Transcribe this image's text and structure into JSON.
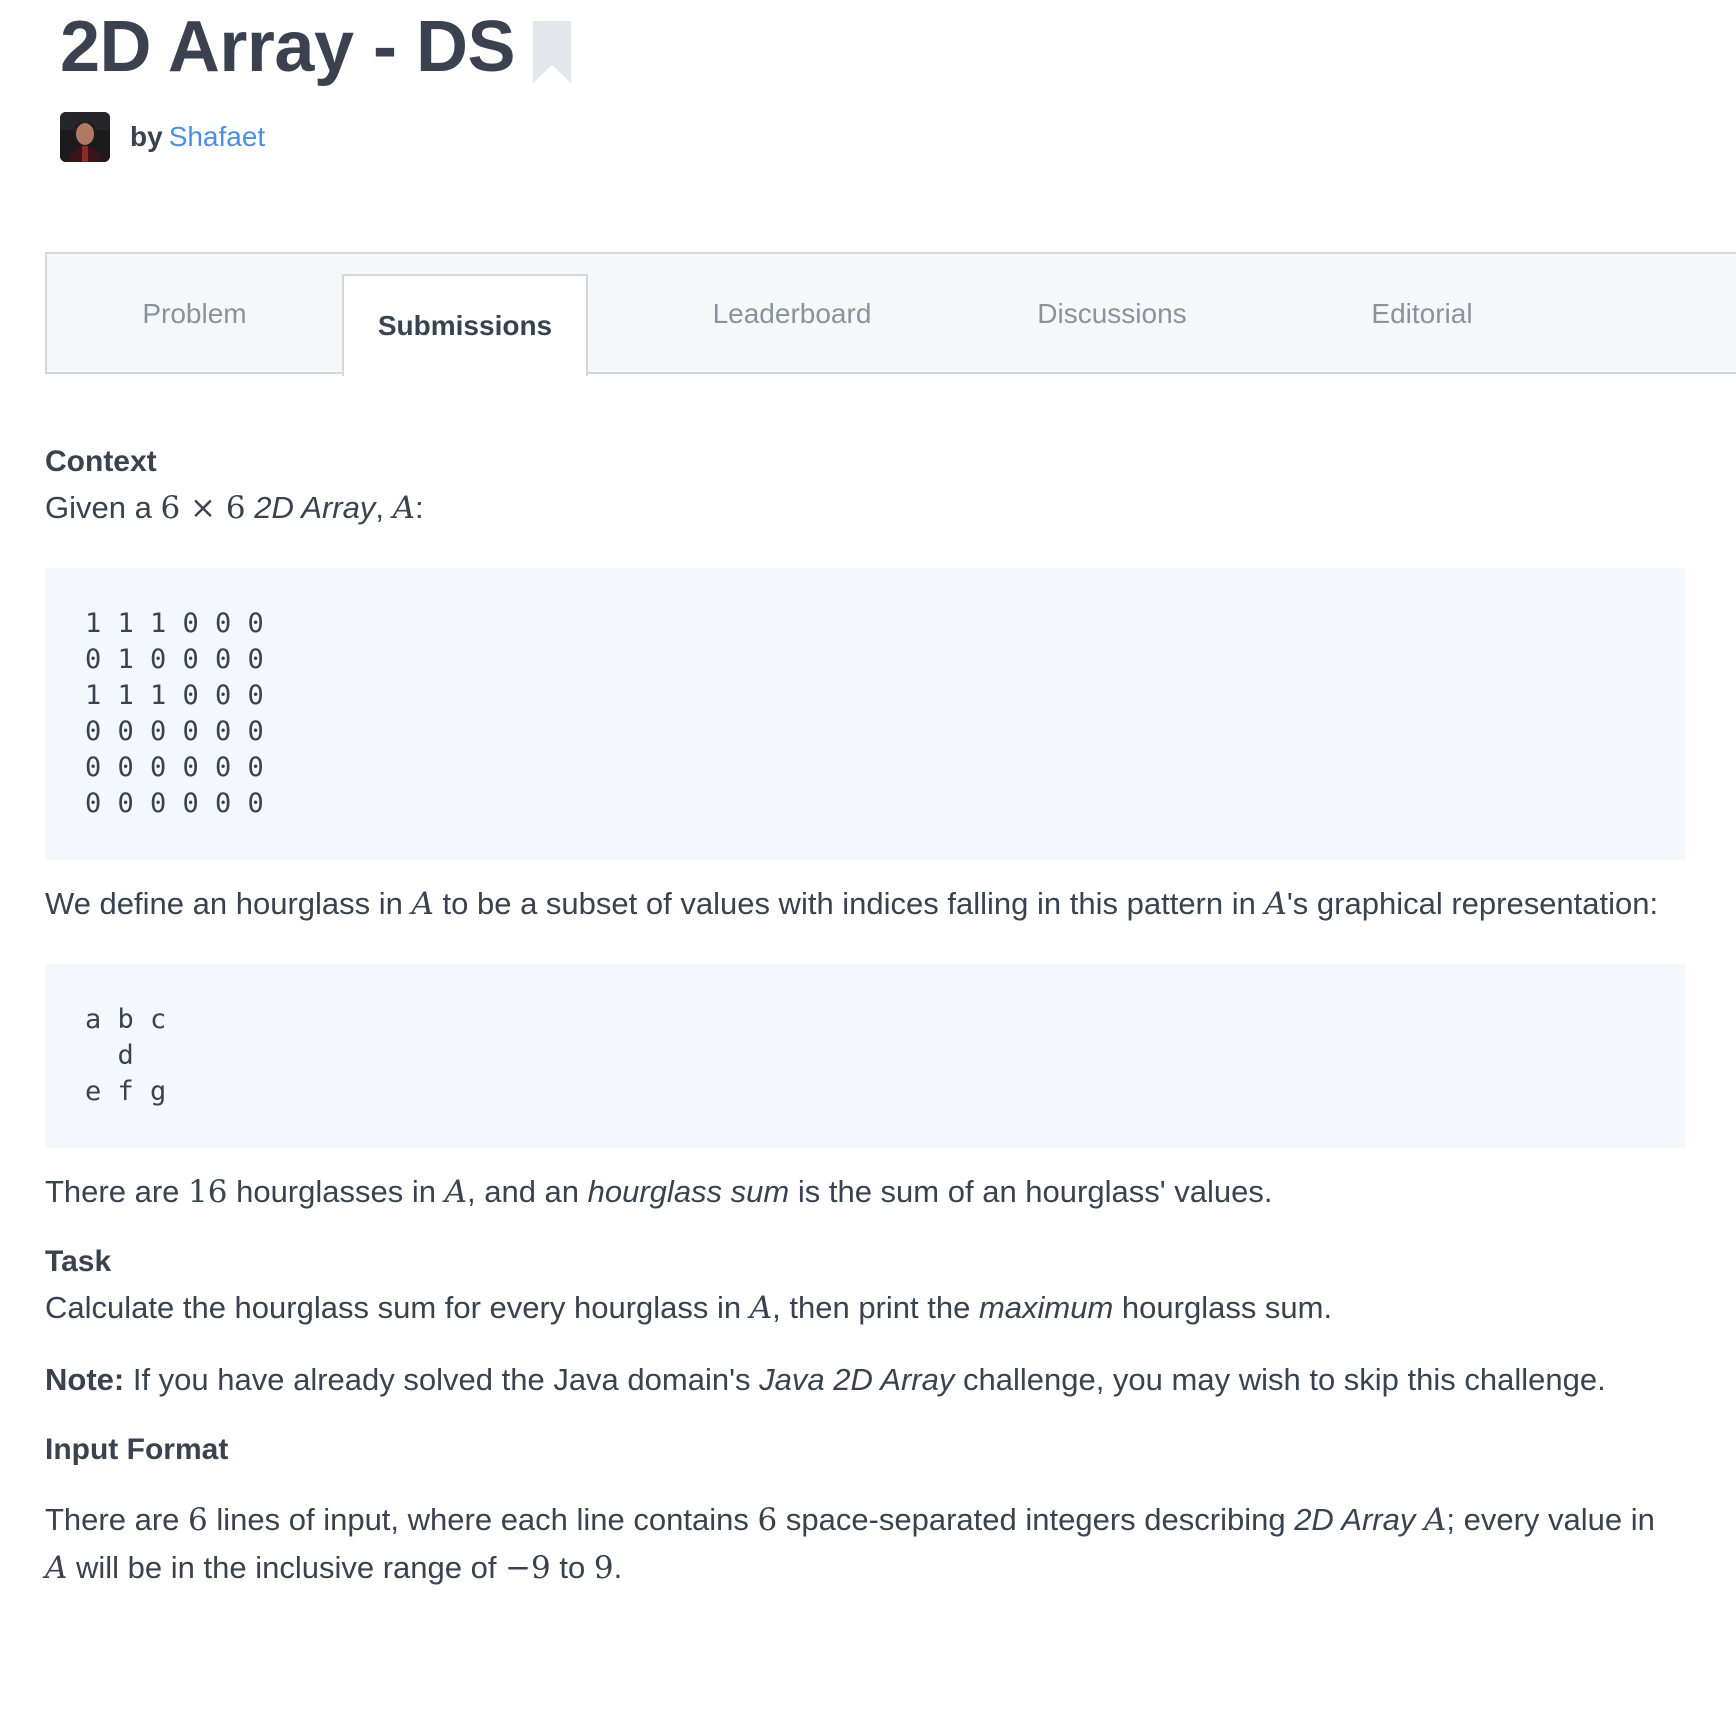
{
  "header": {
    "title": "2D Array - DS",
    "by_label": "by",
    "author": "Shafaet"
  },
  "tabs": [
    {
      "label": "Problem",
      "active": false
    },
    {
      "label": "Submissions",
      "active": true
    },
    {
      "label": "Leaderboard",
      "active": false
    },
    {
      "label": "Discussions",
      "active": false
    },
    {
      "label": "Editorial",
      "active": false
    }
  ],
  "colors": {
    "text": "#39424e",
    "link": "#4a90e2",
    "code_bg": "#f4f8fc",
    "tab_bg": "#f6f7f9",
    "tab_border": "#d3d6db",
    "bookmark": "#e3e6ea"
  },
  "icons": {
    "bookmark": "bookmark-icon",
    "avatar": "author-avatar"
  },
  "context": {
    "heading": "Context",
    "intro": {
      "t1": "Given a ",
      "dims": "6 × 6",
      "t2": " ",
      "em": "2D Array",
      "t3": ", ",
      "var": "A",
      "t4": ":"
    },
    "array_rows": [
      "1 1 1 0 0 0",
      "0 1 0 0 0 0",
      "1 1 1 0 0 0",
      "0 0 0 0 0 0",
      "0 0 0 0 0 0",
      "0 0 0 0 0 0"
    ],
    "define": {
      "t1": "We define an hourglass in ",
      "var1": "A",
      "t2": " to be a subset of values with indices falling in this pattern in ",
      "var2": "A",
      "t3": "'s graphical representation:"
    },
    "pattern_rows": [
      "a b c",
      "  d",
      "e f g"
    ],
    "count": {
      "t1": "There are ",
      "n": "16",
      "t2": " hourglasses in ",
      "var": "A",
      "t3": ", and an ",
      "em": "hourglass sum",
      "t4": " is the sum of an hourglass' values."
    }
  },
  "task": {
    "heading": "Task",
    "text": {
      "t1": "Calculate the hourglass sum for every hourglass in ",
      "var": "A",
      "t2": ", then print the ",
      "em": "maximum",
      "t3": " hourglass sum."
    }
  },
  "note": {
    "label": "Note:",
    "t1": " If you have already solved the Java domain's ",
    "em": "Java 2D Array",
    "t2": " challenge, you may wish to skip this challenge."
  },
  "input_format": {
    "heading": "Input Format",
    "text": {
      "t1": "There are ",
      "n1": "6",
      "t2": " lines of input, where each line contains ",
      "n2": "6",
      "t3": " space-separated integers describing ",
      "em": "2D Array",
      "t4": " ",
      "var1": "A",
      "t5": "; every value in ",
      "var2": "A",
      "t6": " will be in the inclusive range of ",
      "min": "−9",
      "t7": " to ",
      "max": "9",
      "t8": "."
    }
  }
}
